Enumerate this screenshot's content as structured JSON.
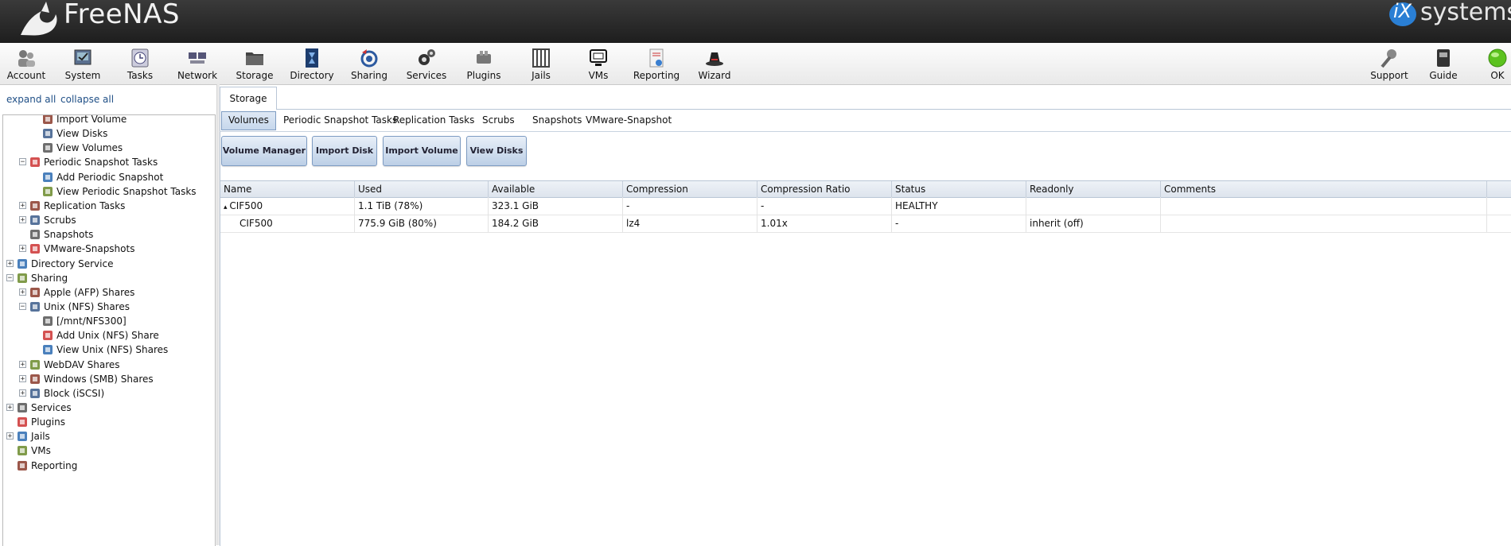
{
  "header": {
    "brand": "FreeNAS",
    "company": "systems",
    "company_prefix": "iX"
  },
  "toolbar": {
    "items": [
      {
        "label": "Account",
        "icon": "account-icon"
      },
      {
        "label": "System",
        "icon": "system-icon"
      },
      {
        "label": "Tasks",
        "icon": "tasks-icon"
      },
      {
        "label": "Network",
        "icon": "network-icon"
      },
      {
        "label": "Storage",
        "icon": "storage-icon"
      },
      {
        "label": "Directory",
        "icon": "directory-icon"
      },
      {
        "label": "Sharing",
        "icon": "sharing-icon"
      },
      {
        "label": "Services",
        "icon": "services-icon"
      },
      {
        "label": "Plugins",
        "icon": "plugins-icon"
      },
      {
        "label": "Jails",
        "icon": "jails-icon"
      },
      {
        "label": "VMs",
        "icon": "vms-icon"
      },
      {
        "label": "Reporting",
        "icon": "reporting-icon"
      },
      {
        "label": "Wizard",
        "icon": "wizard-icon"
      }
    ],
    "right_items": [
      {
        "label": "Support",
        "icon": "support-icon"
      },
      {
        "label": "Guide",
        "icon": "guide-icon"
      },
      {
        "label": "OK",
        "icon": "status-ok-icon"
      }
    ]
  },
  "tree_controls": {
    "expand_all": "expand all",
    "collapse_all": "collapse all"
  },
  "tree": [
    {
      "label": "Import Volume",
      "level": 2,
      "expander": ""
    },
    {
      "label": "View Disks",
      "level": 2,
      "expander": ""
    },
    {
      "label": "View Volumes",
      "level": 2,
      "expander": ""
    },
    {
      "label": "Periodic Snapshot Tasks",
      "level": 1,
      "expander": "−"
    },
    {
      "label": "Add Periodic Snapshot",
      "level": 2,
      "expander": ""
    },
    {
      "label": "View Periodic Snapshot Tasks",
      "level": 2,
      "expander": ""
    },
    {
      "label": "Replication Tasks",
      "level": 1,
      "expander": "+"
    },
    {
      "label": "Scrubs",
      "level": 1,
      "expander": "+"
    },
    {
      "label": "Snapshots",
      "level": 1,
      "expander": ""
    },
    {
      "label": "VMware-Snapshots",
      "level": 1,
      "expander": "+"
    },
    {
      "label": "Directory Service",
      "level": 0,
      "expander": "+"
    },
    {
      "label": "Sharing",
      "level": 0,
      "expander": "−"
    },
    {
      "label": "Apple (AFP) Shares",
      "level": 1,
      "expander": "+"
    },
    {
      "label": "Unix (NFS) Shares",
      "level": 1,
      "expander": "−"
    },
    {
      "label": "[/mnt/NFS300]",
      "level": 2,
      "expander": ""
    },
    {
      "label": "Add Unix (NFS) Share",
      "level": 2,
      "expander": ""
    },
    {
      "label": "View Unix (NFS) Shares",
      "level": 2,
      "expander": ""
    },
    {
      "label": "WebDAV Shares",
      "level": 1,
      "expander": "+"
    },
    {
      "label": "Windows (SMB) Shares",
      "level": 1,
      "expander": "+"
    },
    {
      "label": "Block (iSCSI)",
      "level": 1,
      "expander": "+"
    },
    {
      "label": "Services",
      "level": 0,
      "expander": "+"
    },
    {
      "label": "Plugins",
      "level": 0,
      "expander": ""
    },
    {
      "label": "Jails",
      "level": 0,
      "expander": "+"
    },
    {
      "label": "VMs",
      "level": 0,
      "expander": ""
    },
    {
      "label": "Reporting",
      "level": 0,
      "expander": ""
    }
  ],
  "main": {
    "outer_tab": "Storage",
    "subtabs": [
      "Volumes",
      "Periodic Snapshot Tasks",
      "Replication Tasks",
      "Scrubs",
      "Snapshots",
      "VMware-Snapshot"
    ],
    "buttons": [
      "Volume Manager",
      "Import Disk",
      "Import Volume",
      "View Disks"
    ],
    "grid": {
      "columns": [
        "Name",
        "Used",
        "Available",
        "Compression",
        "Compression Ratio",
        "Status",
        "Readonly",
        "Comments"
      ],
      "rows": [
        {
          "expander": "▴",
          "cells": [
            "CIF500",
            "1.1 TiB (78%)",
            "323.1 GiB",
            "-",
            "-",
            "HEALTHY",
            "",
            ""
          ]
        },
        {
          "expander": "",
          "cells": [
            "CIF500",
            "775.9 GiB (80%)",
            "184.2 GiB",
            "lz4",
            "1.01x",
            "-",
            "inherit (off)",
            ""
          ]
        }
      ]
    }
  }
}
